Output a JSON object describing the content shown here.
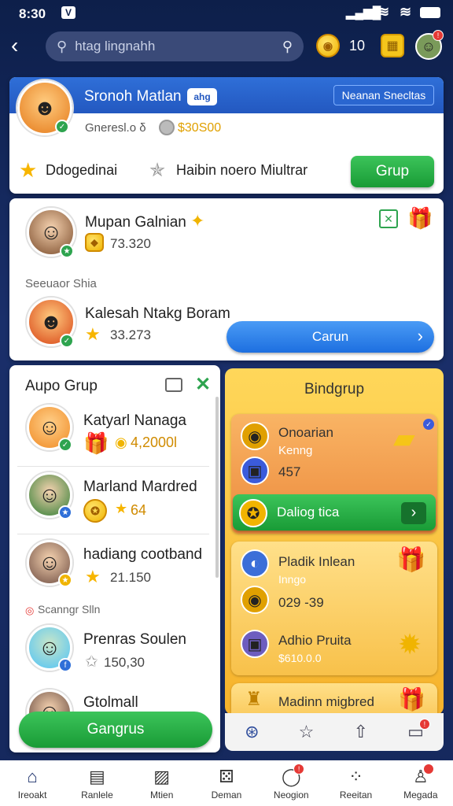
{
  "status": {
    "time": "8:30"
  },
  "search": {
    "placeholder": "htag lingnahh"
  },
  "header": {
    "coins": "10"
  },
  "profile": {
    "name": "Sronoh Matlan",
    "tag": "ahg",
    "action_label": "Neanan Snecltas",
    "subtitle": "Gneresl.o δ",
    "amount": "$30S00",
    "star_label": "Ddogedinai",
    "mission_label": "Haibin noero Miultrar",
    "group_button": "Grup"
  },
  "featured": {
    "row1_name": "Mupan Galnian",
    "row1_value": "73.320",
    "section_label": "Seeuaor Shia",
    "row2_name": "Kalesah Ntakg Boram",
    "row2_value": "33.273",
    "cta_label": "Carun"
  },
  "left_panel": {
    "title": "Aupo Grup",
    "members": [
      {
        "name": "Katyarl Nanaga",
        "value": "4,2000l"
      },
      {
        "name": "Marland Mardred",
        "value": "64"
      },
      {
        "name": "hadiang cootband",
        "value": "21.150"
      }
    ],
    "section_label": "Scanngr Slln",
    "members2": [
      {
        "name": "Prenras Soulen",
        "value": "150,30"
      },
      {
        "name": "Gtolmall",
        "value": ""
      }
    ],
    "button": "Gangrus"
  },
  "right_panel": {
    "title": "Bindgrup",
    "card1": {
      "title": "Onoarian",
      "subtitle": "Kenng",
      "value": "457",
      "button": "Daliog tica"
    },
    "card2": {
      "title": "Pladik Inlean",
      "subtitle": "Inngo",
      "value": "029 -39"
    },
    "card3": {
      "title": "Adhio Pruita",
      "value": "$610.0.0"
    },
    "card4": {
      "title": "Madinn migbred"
    }
  },
  "nav": [
    {
      "label": "Ireoakt",
      "icon": "home-icon"
    },
    {
      "label": "Ranlele",
      "icon": "cards-icon"
    },
    {
      "label": "Mtien",
      "icon": "box-icon"
    },
    {
      "label": "Deman",
      "icon": "dice-icon"
    },
    {
      "label": "Neogion",
      "icon": "chat-icon"
    },
    {
      "label": "Reeitan",
      "icon": "grid-icon"
    },
    {
      "label": "Megada",
      "icon": "profile-icon"
    }
  ]
}
